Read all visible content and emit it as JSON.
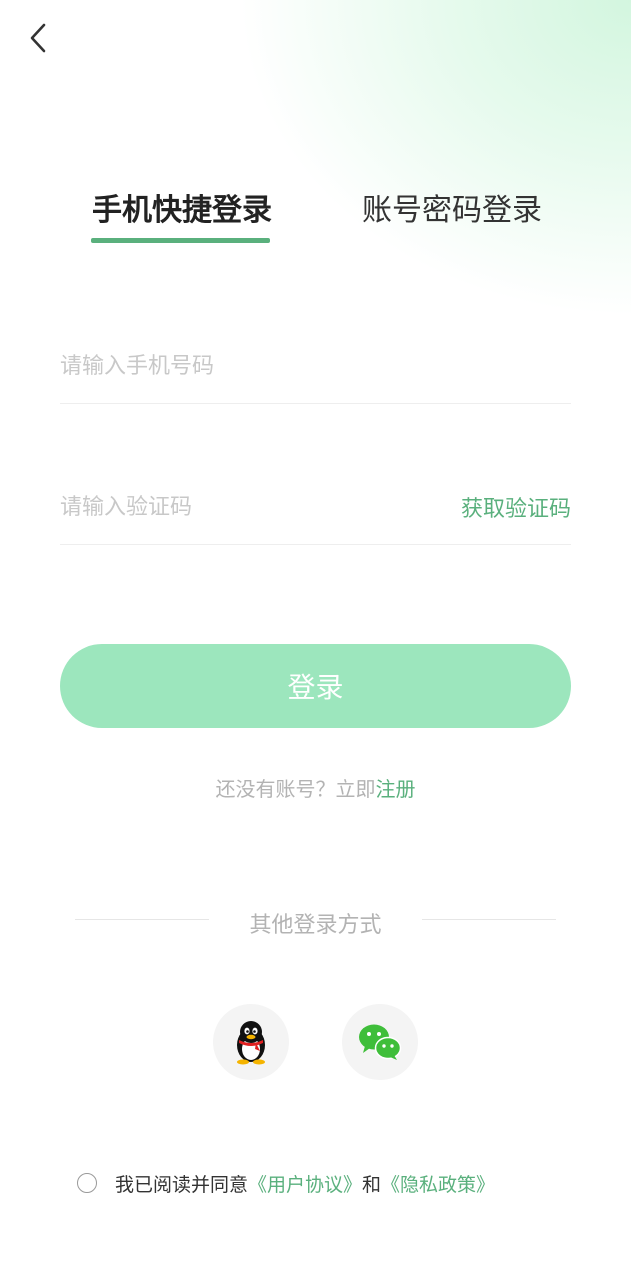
{
  "tabs": [
    {
      "label": "手机快捷登录",
      "active": true
    },
    {
      "label": "账号密码登录",
      "active": false
    }
  ],
  "phone": {
    "placeholder": "请输入手机号码",
    "value": ""
  },
  "code": {
    "placeholder": "请输入验证码",
    "value": "",
    "get_code_label": "获取验证码"
  },
  "login_label": "登录",
  "register": {
    "prompt": "还没有账号？立即",
    "link": "注册"
  },
  "other_login_label": "其他登录方式",
  "social": [
    {
      "name": "qq",
      "icon": "qq-penguin-icon"
    },
    {
      "name": "wechat",
      "icon": "wechat-icon"
    }
  ],
  "agreement": {
    "prefix": "我已阅读并同意",
    "user_agreement": "《用户协议》",
    "and": "和",
    "privacy_policy": "《隐私政策》",
    "checked": false
  },
  "colors": {
    "accent": "#5ab07d",
    "button": "#9ce6bd",
    "placeholder": "#c8c8c8",
    "muted": "#b3b3b3"
  }
}
